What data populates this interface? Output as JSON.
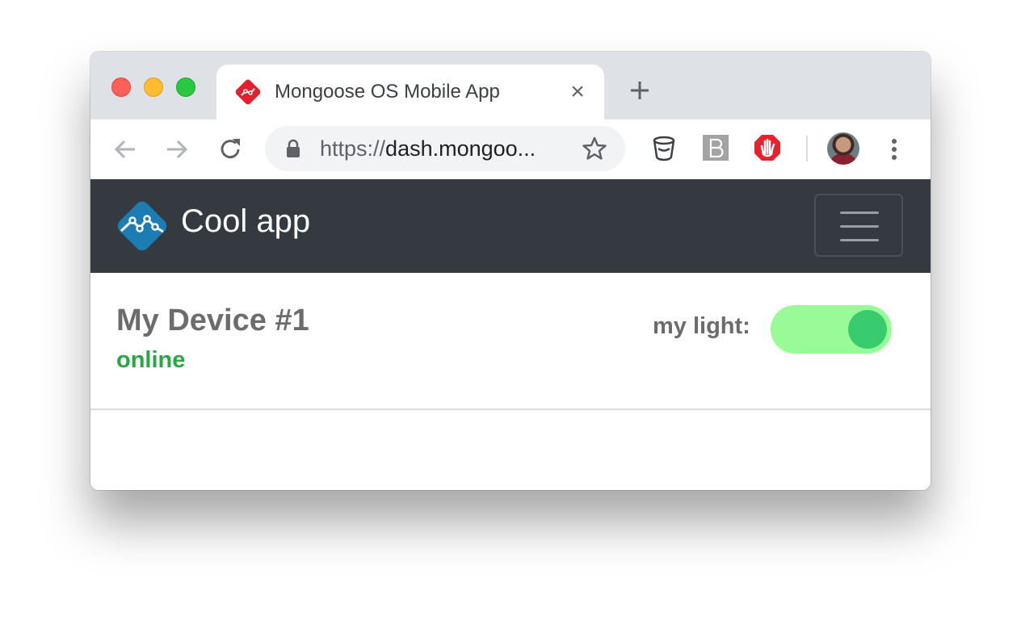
{
  "browser": {
    "tab_title": "Mongoose OS Mobile App",
    "tab_close": "×",
    "url_scheme": "https://",
    "url_host": "dash.mongoo...",
    "icons": [
      "back-arrow-icon",
      "forward-arrow-icon",
      "reload-icon",
      "lock-icon",
      "star-icon",
      "bucket-extension-icon",
      "b-extension-icon",
      "adblock-icon",
      "profile-avatar",
      "kebab-menu-icon"
    ]
  },
  "navbar": {
    "brand_name": "Cool app",
    "background": "#343a40"
  },
  "device": {
    "name": "My Device #1",
    "status": "online",
    "status_color": "#28a745",
    "light_label": "my light:",
    "light_on": true,
    "toggle_color": "#98fb98",
    "knob_color": "#39cc6f"
  }
}
